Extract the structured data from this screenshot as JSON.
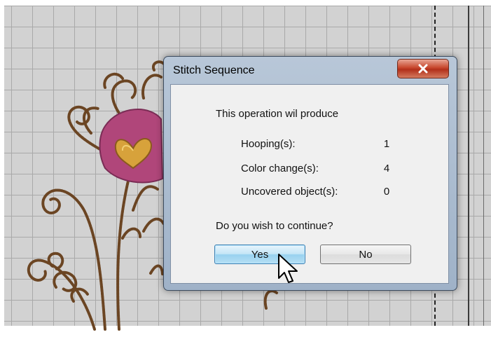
{
  "dialog": {
    "title": "Stitch Sequence",
    "close_icon": "x-close-icon",
    "intro": "This operation wil produce",
    "stats": [
      {
        "label": "Hooping(s):",
        "value": "1"
      },
      {
        "label": "Color change(s):",
        "value": "4"
      },
      {
        "label": "Uncovered object(s):",
        "value": "0"
      }
    ],
    "question": "Do you wish to continue?",
    "yes_label": "Yes",
    "no_label": "No"
  },
  "colors": {
    "canvas": "#d2d2d2",
    "grid": "#a9a9a9",
    "embroidery_brown": "#6b4523",
    "embroidery_pink": "#b0467a",
    "embroidery_gold": "#d7a23b",
    "close_button": "#c7462c"
  }
}
